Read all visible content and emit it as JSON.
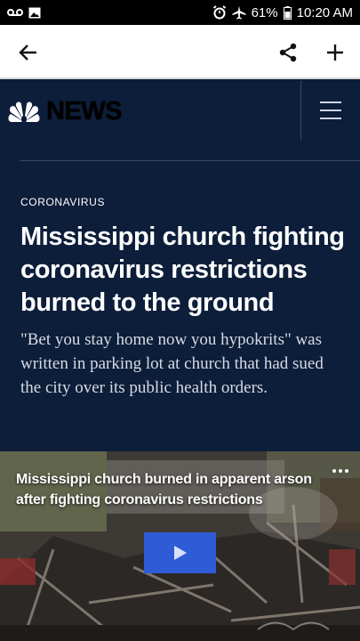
{
  "status_bar": {
    "battery": "61%",
    "time": "10:20 AM",
    "icons": [
      "voicemail-icon",
      "image-icon",
      "alarm-icon",
      "airplane-mode-icon",
      "battery-icon"
    ]
  },
  "toolbar": {
    "back_icon": "back-arrow-icon",
    "share_icon": "share-icon",
    "add_icon": "plus-icon"
  },
  "site": {
    "logo_text": "NEWS",
    "logo_icon": "peacock-icon",
    "menu_icon": "hamburger-menu-icon"
  },
  "article": {
    "category": "CORONAVIRUS",
    "headline": "Mississippi church fighting coronavirus restrictions burned to the ground",
    "dek": "\"Bet you stay home now you hypokrits\" was written in parking lot at church that had sued the city over its public health orders."
  },
  "video": {
    "title": "Mississippi church burned in apparent arson after fighting coronavirus restrictions",
    "play_icon": "play-icon",
    "more_icon": "more-options-icon"
  },
  "colors": {
    "page_bg": "#0d1e3a",
    "play_button": "#2f5cd6",
    "toolbar_bg": "#ffffff"
  }
}
